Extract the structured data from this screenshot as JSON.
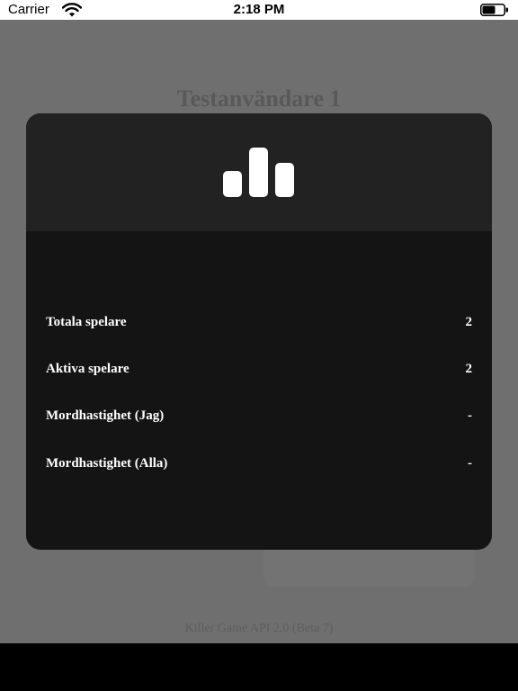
{
  "status_bar": {
    "carrier": "Carrier",
    "time": "2:18 PM",
    "wifi_icon": "wifi-icon",
    "battery_icon": "battery-icon"
  },
  "background": {
    "title": "Testanvändare 1",
    "footer": "Killer Game API 2.0 (Beta 7)"
  },
  "modal": {
    "header_icon": "bar-chart-icon",
    "stats": [
      {
        "label": "Totala spelare",
        "value": "2"
      },
      {
        "label": "Aktiva spelare",
        "value": "2"
      },
      {
        "label": "Mordhastighet (Jag)",
        "value": "-"
      },
      {
        "label": "Mordhastighet (Alla)",
        "value": "-"
      }
    ]
  },
  "colors": {
    "dimmed_background": "#6f6f6f",
    "modal_body": "#141414",
    "modal_header": "#222222",
    "text": "#ffffff"
  }
}
